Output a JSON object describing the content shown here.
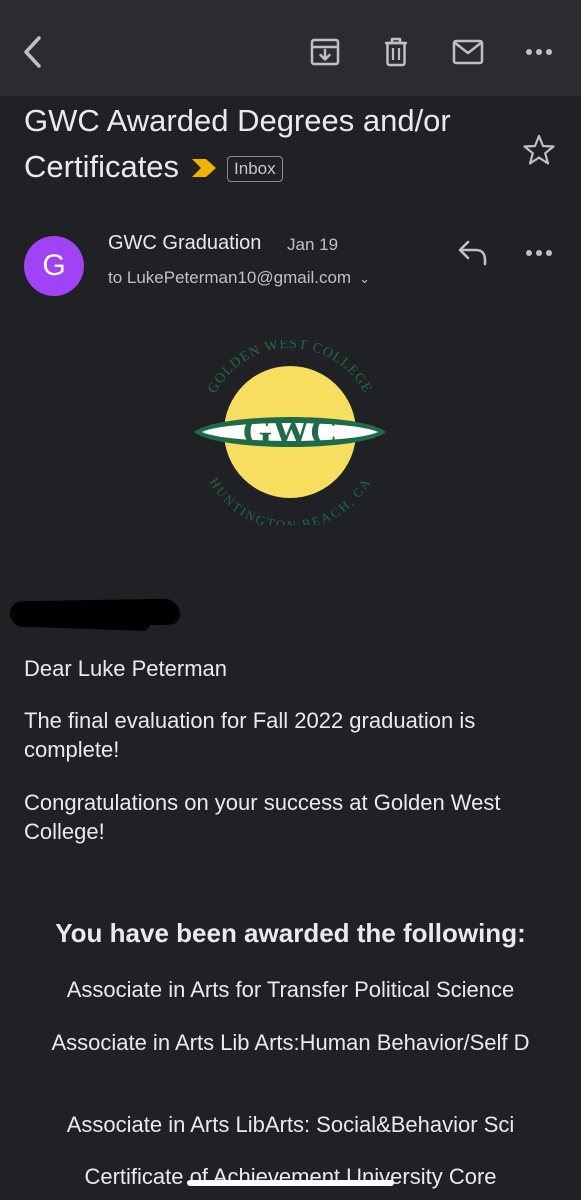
{
  "email": {
    "subject": "GWC Awarded Degrees and/or Certificates",
    "label": "Inbox",
    "sender": "GWC Graduation",
    "avatar_letter": "G",
    "date": "Jan 19",
    "to": "to LukePeterman10@gmail.com"
  },
  "logo": {
    "text_top": "GOLDEN WEST COLLEGE",
    "text_center": "GWC",
    "text_bottom": "HUNTINGTON BEACH, CA"
  },
  "body": {
    "greeting": "Dear Luke Peterman",
    "para1": "The final evaluation for Fall 2022 graduation is complete!",
    "para2": "Congratulations on your success at Golden West College!",
    "awards_title": "You have been awarded the following:",
    "awards": [
      "Associate in Arts for Transfer Political Science",
      "Associate in Arts Lib Arts:Human Behavior/Self D",
      "Associate in Arts LibArts: Social&Behavior Sci",
      "Certificate of Achievement University Core"
    ]
  },
  "colors": {
    "background": "#202124",
    "toolbar": "#2b2c2f",
    "avatar": "#a142f4",
    "important_marker": "#f2b400",
    "logo_yellow": "#f6de5e",
    "logo_green": "#1e6b4a"
  },
  "icons": [
    "back-icon",
    "archive-icon",
    "delete-icon",
    "mail-icon",
    "more-icon",
    "important-marker-icon",
    "star-icon",
    "reply-icon",
    "chevron-down-icon"
  ]
}
